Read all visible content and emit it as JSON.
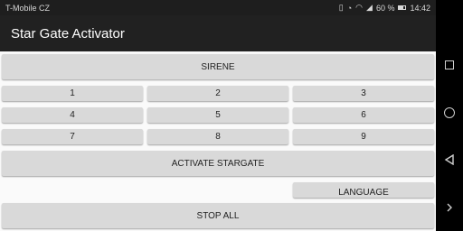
{
  "status_bar": {
    "carrier": "T-Mobile CZ",
    "battery_percent": "60 %",
    "time": "14:42"
  },
  "app_bar": {
    "title": "Star Gate Activator"
  },
  "buttons": {
    "sirene": "SIRENE",
    "numbers": [
      "1",
      "2",
      "3",
      "4",
      "5",
      "6",
      "7",
      "8",
      "9"
    ],
    "activate": "ACTIVATE STARGATE",
    "language": "LANGUAGE",
    "stop_all": "STOP ALL"
  },
  "nav_bar": {
    "icons": [
      "recents-square-icon",
      "home-circle-icon",
      "back-triangle-icon",
      "expand-chevron-icon"
    ]
  }
}
